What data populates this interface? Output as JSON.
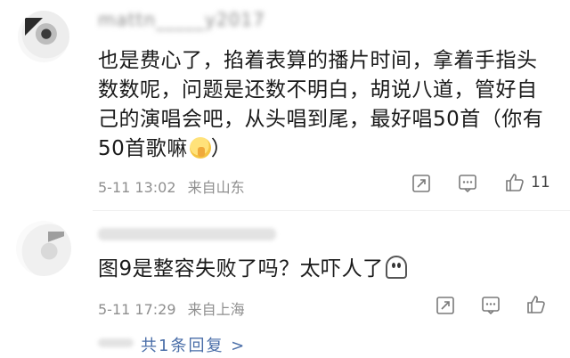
{
  "comments": [
    {
      "username": "mattn_____y2017",
      "text": "也是费心了，掐着表算的播片时间，拿着手指头数数呢，问题是还数不明白，胡说八道，管好自己的演唱会吧，从头唱到尾，最好唱50首（你有50首歌嘛",
      "text_end": "）",
      "emoji": "shushing-face-emoji",
      "time": "5-11 13:02",
      "source": "来自山东",
      "likes": "11"
    },
    {
      "username": "",
      "text": "图9是整容失败了吗？太吓人了",
      "emoji": "ghost-emoji",
      "time": "5-11 17:29",
      "source": "来自上海",
      "likes": ""
    }
  ],
  "replies": {
    "label": "共1条回复 >"
  },
  "icons": [
    "share-icon",
    "comment-icon",
    "thumbs-up-icon"
  ],
  "colors": {
    "meta": "#8f8f8f",
    "link": "#4a6ea8",
    "text": "#1a1a1a"
  }
}
